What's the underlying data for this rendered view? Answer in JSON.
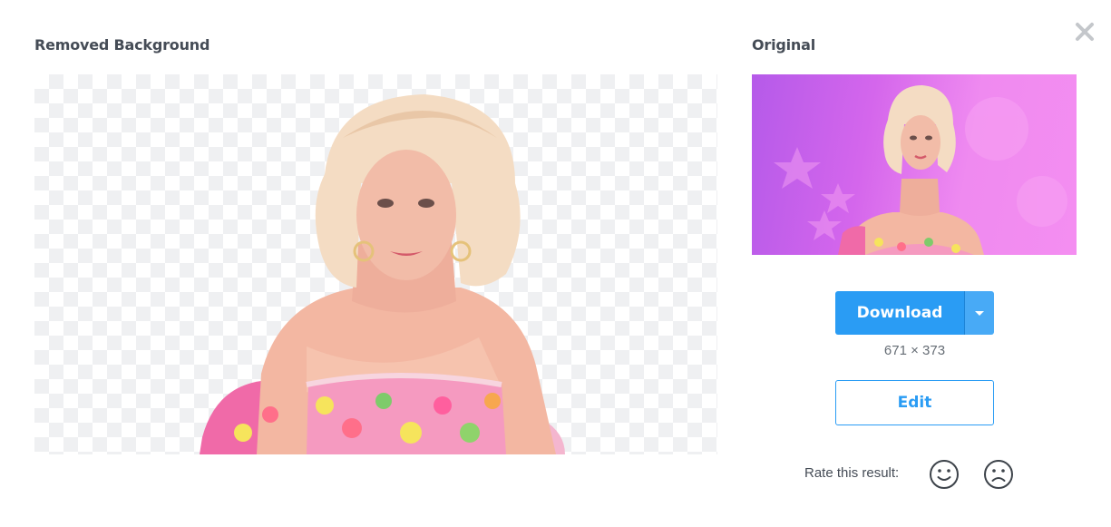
{
  "panels": {
    "removed_title": "Removed Background",
    "original_title": "Original"
  },
  "actions": {
    "download_label": "Download",
    "dimensions": "671 × 373",
    "edit_label": "Edit"
  },
  "rating": {
    "prompt": "Rate this result:"
  },
  "icons": {
    "close": "close-icon",
    "download_menu": "chevron-down-icon",
    "happy": "smiley-face-icon",
    "sad": "sad-face-icon"
  },
  "colors": {
    "accent": "#2a9cf4",
    "heading": "#454c56",
    "checker": "#eff0f2",
    "original_bg": "#d466ec"
  }
}
